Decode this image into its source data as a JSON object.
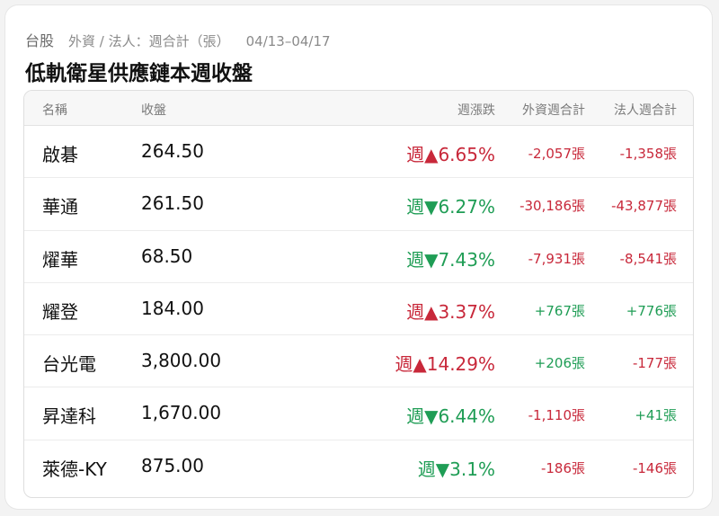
{
  "header": {
    "market": "台股",
    "meta": "外資 / 法人：週合計（張）",
    "range": "04/13–04/17",
    "title": "低軌衛星供應鏈本週收盤"
  },
  "columns": {
    "name": "名稱",
    "close": "收盤",
    "change": "週漲跌",
    "foreign": "外資週合計",
    "institutional": "法人週合計"
  },
  "colors": {
    "up": "#c8283a",
    "down": "#1f9d55"
  },
  "rows": [
    {
      "name": "啟碁",
      "close": "264.50",
      "change": "週▲6.65%",
      "change_dir": "up",
      "foreign": "-2,057張",
      "foreign_dir": "up",
      "inst": "-1,358張",
      "inst_dir": "up"
    },
    {
      "name": "華通",
      "close": "261.50",
      "change": "週▼6.27%",
      "change_dir": "down",
      "foreign": "-30,186張",
      "foreign_dir": "up",
      "inst": "-43,877張",
      "inst_dir": "up"
    },
    {
      "name": "燿華",
      "close": "68.50",
      "change": "週▼7.43%",
      "change_dir": "down",
      "foreign": "-7,931張",
      "foreign_dir": "up",
      "inst": "-8,541張",
      "inst_dir": "up"
    },
    {
      "name": "耀登",
      "close": "184.00",
      "change": "週▲3.37%",
      "change_dir": "up",
      "foreign": "+767張",
      "foreign_dir": "down",
      "inst": "+776張",
      "inst_dir": "down"
    },
    {
      "name": "台光電",
      "close": "3,800.00",
      "change": "週▲14.29%",
      "change_dir": "up",
      "foreign": "+206張",
      "foreign_dir": "down",
      "inst": "-177張",
      "inst_dir": "up"
    },
    {
      "name": "昇達科",
      "close": "1,670.00",
      "change": "週▼6.44%",
      "change_dir": "down",
      "foreign": "-1,110張",
      "foreign_dir": "up",
      "inst": "+41張",
      "inst_dir": "down"
    },
    {
      "name": "萊德-KY",
      "close": "875.00",
      "change": "週▼3.1%",
      "change_dir": "down",
      "foreign": "-186張",
      "foreign_dir": "up",
      "inst": "-146張",
      "inst_dir": "up"
    }
  ]
}
